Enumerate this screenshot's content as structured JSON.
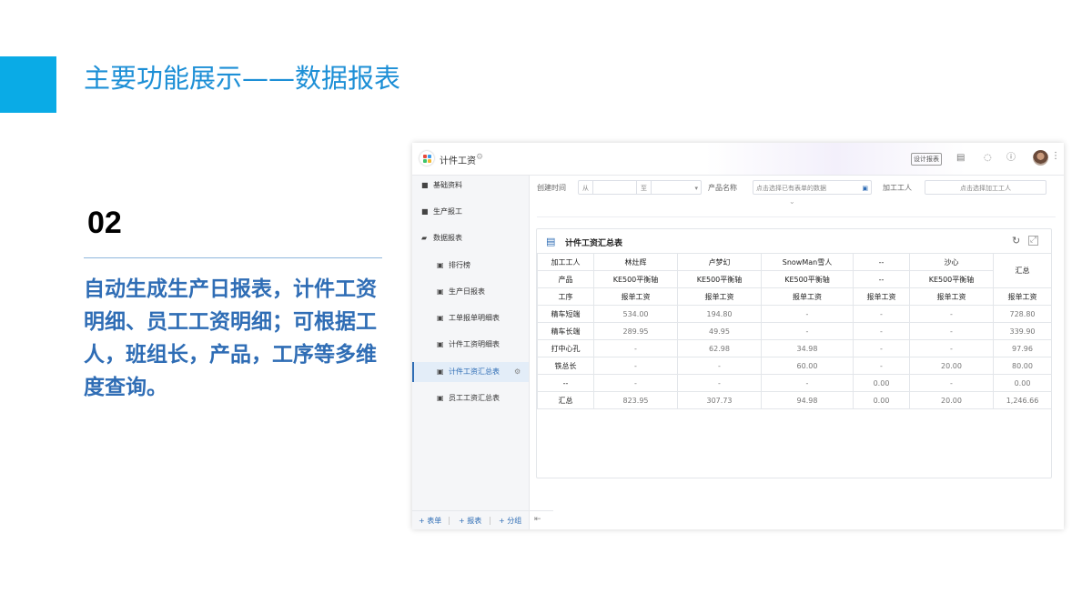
{
  "slide": {
    "title": "主要功能展示——数据报表",
    "number": "02",
    "body": "自动生成生产日报表，计件工资明细、员工工资明细；可根据工人，班组长，产品，工序等多维度查询。"
  },
  "app": {
    "title": "计件工资",
    "design_button": "设计报表",
    "sidebar": {
      "items": [
        {
          "label": "基础资料",
          "icon": "folder-icon"
        },
        {
          "label": "生产报工",
          "icon": "folder-icon"
        },
        {
          "label": "数据报表",
          "icon": "folder-open-icon"
        },
        {
          "label": "排行榜",
          "icon": "report-icon"
        },
        {
          "label": "生产日报表",
          "icon": "report-icon"
        },
        {
          "label": "工单报单明细表",
          "icon": "report-icon"
        },
        {
          "label": "计件工资明细表",
          "icon": "report-icon"
        },
        {
          "label": "计件工资汇总表",
          "icon": "report-icon",
          "active": true
        },
        {
          "label": "员工工资汇总表",
          "icon": "report-icon"
        }
      ],
      "footer": [
        "+ 表单",
        "+ 报表",
        "+ 分组"
      ]
    },
    "filters": {
      "created_label": "创建时间",
      "from_label": "从",
      "to_label": "至",
      "product_label": "产品名称",
      "product_placeholder": "点击选择已有表单的数据",
      "worker_label": "加工工人",
      "worker_placeholder": "点击选择加工工人"
    },
    "report": {
      "title": "计件工资汇总表",
      "rows": [
        [
          "加工工人",
          "林灶辉",
          "卢梦幻",
          "SnowMan雪人",
          "--",
          "沙心",
          "汇总"
        ],
        [
          "产品",
          "KE500平衡轴",
          "KE500平衡轴",
          "KE500平衡轴",
          "--",
          "KE500平衡轴"
        ],
        [
          "工序",
          "报单工资",
          "报单工资",
          "报单工资",
          "报单工资",
          "报单工资",
          "报单工资"
        ],
        [
          "精车短端",
          "534.00",
          "194.80",
          "-",
          "-",
          "-",
          "728.80"
        ],
        [
          "精车长端",
          "289.95",
          "49.95",
          "-",
          "-",
          "-",
          "339.90"
        ],
        [
          "打中心孔",
          "-",
          "62.98",
          "34.98",
          "-",
          "-",
          "97.96"
        ],
        [
          "铁总长",
          "-",
          "-",
          "60.00",
          "-",
          "20.00",
          "80.00"
        ],
        [
          "--",
          "-",
          "-",
          "-",
          "0.00",
          "-",
          "0.00"
        ],
        [
          "汇总",
          "823.95",
          "307.73",
          "94.98",
          "0.00",
          "20.00",
          "1,246.66"
        ]
      ]
    }
  },
  "colors": {
    "accent": "#0aabe6",
    "title": "#1d8fd6",
    "body_text": "#2f6db5"
  }
}
